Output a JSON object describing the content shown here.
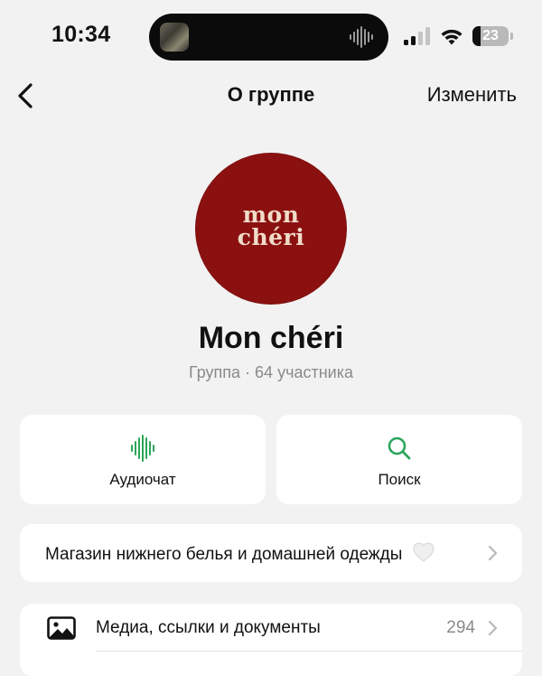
{
  "status_bar": {
    "time": "10:34",
    "battery": "23",
    "battery_level": 0.23
  },
  "nav": {
    "title": "О группе",
    "edit_label": "Изменить"
  },
  "group": {
    "logo_line1": "mon",
    "logo_line2": "chéri",
    "name": "Mon chéri",
    "subtitle": "Группа · 64 участника",
    "avatar_color": "#8b1111"
  },
  "actions": [
    {
      "label": "Аудиочат",
      "icon": "audio-wave-icon",
      "color": "#2aa65a"
    },
    {
      "label": "Поиск",
      "icon": "search-icon",
      "color": "#2aa65a"
    }
  ],
  "description": {
    "text": "Магазин нижнего белья и домашней одежды",
    "emoji": "white-heart-icon"
  },
  "media": {
    "label": "Медиа, ссылки и документы",
    "count": "294",
    "icon": "image-icon"
  }
}
